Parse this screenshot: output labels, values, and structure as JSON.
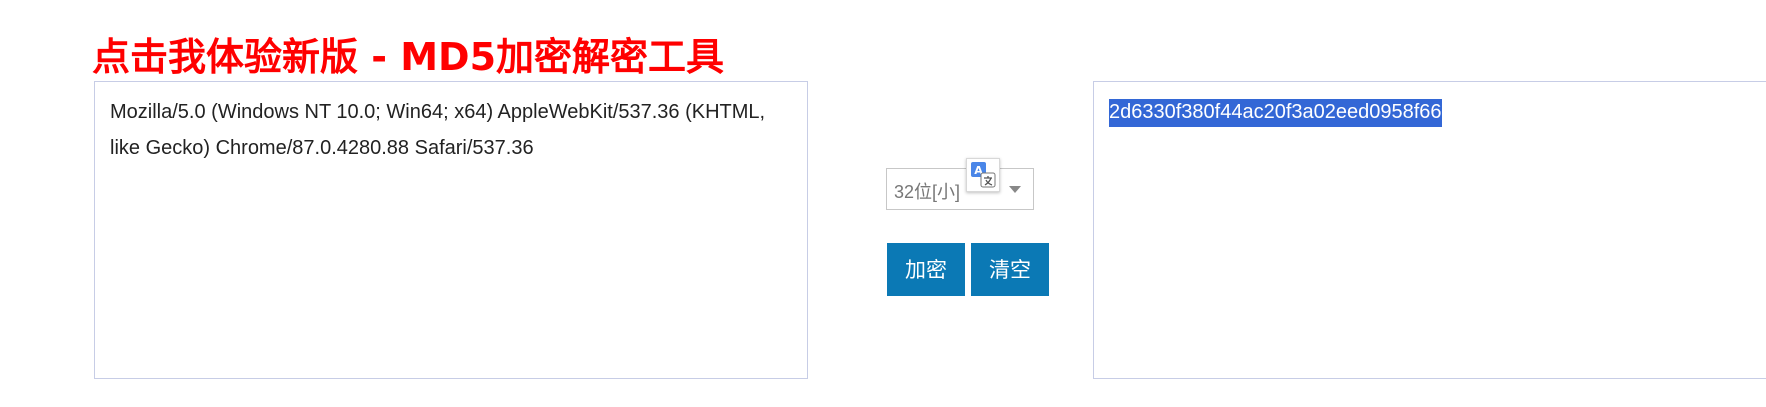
{
  "header": {
    "title": "点击我体验新版 - MD5加密解密工具",
    "title_color": "#ff0000"
  },
  "input": {
    "value": "Mozilla/5.0 (Windows NT 10.0; Win64; x64) AppleWebKit/537.36 (KHTML, like Gecko) Chrome/87.0.4280.88 Safari/537.36"
  },
  "options": {
    "mode_selected": "32位[小]"
  },
  "actions": {
    "encrypt_label": "加密",
    "clear_label": "清空",
    "button_color": "#0b79b5"
  },
  "output": {
    "value": "2d6330f380f44ac20f3a02eed0958f66",
    "selection_color": "#3367d6"
  },
  "icons": {
    "translate": "translate-icon"
  }
}
